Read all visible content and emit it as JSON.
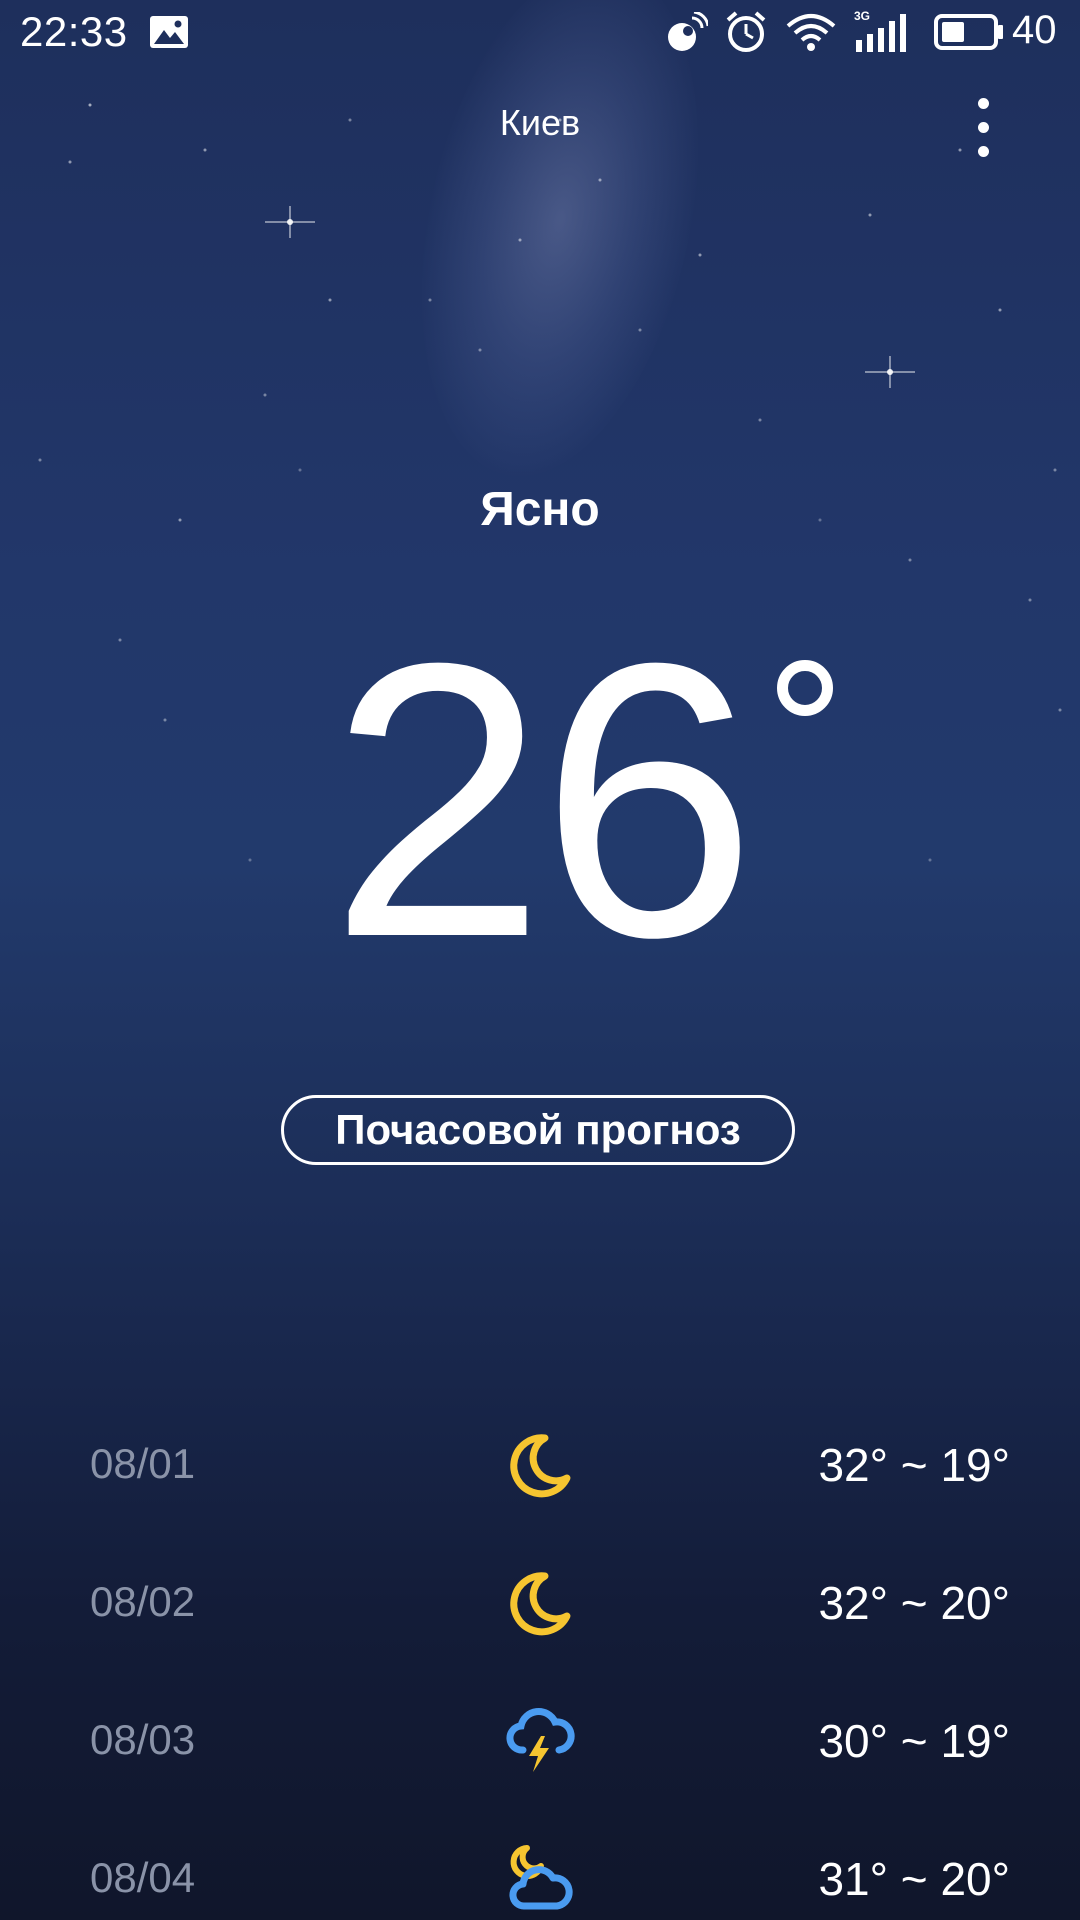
{
  "status_bar": {
    "time": "22:33",
    "battery": "40",
    "network_label": "3G",
    "icons": [
      "image-icon",
      "satellite-icon",
      "alarm-icon",
      "wifi-icon",
      "signal-icon",
      "battery-icon"
    ]
  },
  "header": {
    "city": "Киев",
    "menu_icon": "more-vertical-icon"
  },
  "current": {
    "condition": "Ясно",
    "temperature": "26"
  },
  "hourly_button": {
    "label": "Почасовой прогноз"
  },
  "forecast": [
    {
      "date": "08/01",
      "icon": "moon-icon",
      "range": "32° ~ 19°"
    },
    {
      "date": "08/02",
      "icon": "moon-icon",
      "range": "32° ~ 20°"
    },
    {
      "date": "08/03",
      "icon": "thunderstorm-icon",
      "range": "30° ~ 19°"
    },
    {
      "date": "08/04",
      "icon": "partly-cloudy-night-icon",
      "range": "31° ~ 20°"
    }
  ],
  "colors": {
    "accent_yellow": "#f6c530",
    "accent_blue": "#4a9bf0",
    "date_gray": "#8a93a8"
  }
}
